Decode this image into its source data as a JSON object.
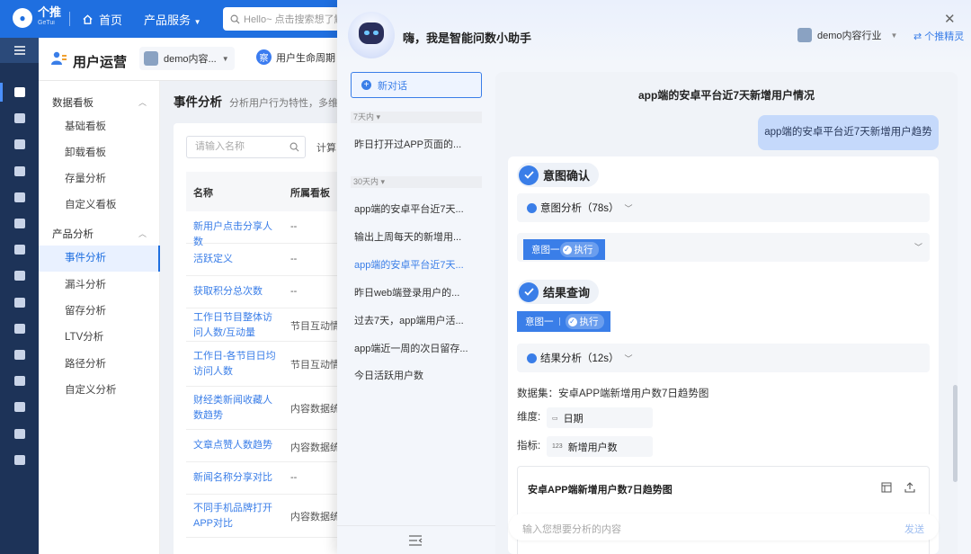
{
  "topbar": {
    "logo_text": "个推",
    "logo_sub": "GeTui",
    "home_label": "首页",
    "product_services": "产品服务",
    "search_placeholder": "Hello~ 点击搜索想了解"
  },
  "subheader": {
    "title": "用户运营",
    "demo_select": "demo内容...",
    "lifecycle_badge": "察",
    "lifecycle_label": "用户生命周期"
  },
  "leftnav": {
    "groups": [
      {
        "label": "数据看板",
        "items": [
          "基础看板",
          "卸载看板",
          "存量分析",
          "自定义看板"
        ]
      },
      {
        "label": "产品分析",
        "items": [
          "事件分析",
          "漏斗分析",
          "留存分析",
          "LTV分析",
          "路径分析",
          "自定义分析"
        ]
      }
    ],
    "active_item": "事件分析"
  },
  "main": {
    "title": "事件分析",
    "subtitle": "分析用户行为特性，多维对",
    "filter_placeholder": "请输入名称",
    "calc_label": "计算",
    "columns": [
      "名称",
      "所属看板"
    ],
    "rows": [
      {
        "name": "新用户点击分享人数",
        "group": "--"
      },
      {
        "name": "活跃定义",
        "group": "--"
      },
      {
        "name": "获取积分总次数",
        "group": "--"
      },
      {
        "name": "工作日节目整体访问人数/互动量",
        "group": "节目互动情"
      },
      {
        "name": "工作日-各节目日均访问人数",
        "group": "节目互动情"
      },
      {
        "name": "财经类新闻收藏人数趋势",
        "group": "内容数据统"
      },
      {
        "name": "文章点赞人数趋势",
        "group": "内容数据统"
      },
      {
        "name": "新闻名称分享对比",
        "group": "--"
      },
      {
        "name": "不同手机品牌打开APP对比",
        "group": "内容数据统"
      }
    ]
  },
  "assistant": {
    "greeting": "嗨，我是智能问数小助手",
    "industry": "demo内容行业",
    "elf_link": "个推精灵",
    "new_chat": "新对话",
    "history": [
      {
        "group": "7天内",
        "items": [
          "昨日打开过APP页面的..."
        ]
      },
      {
        "group": "30天内",
        "items": [
          "app端的安卓平台近7天...",
          "输出上周每天的新增用...",
          "app端的安卓平台近7天...",
          "昨日web端登录用户的...",
          "过去7天，app端用户活...",
          "app端近一周的次日留存...",
          "今日活跃用户数"
        ]
      }
    ],
    "active_history_index": 2,
    "chat": {
      "title": "app端的安卓平台近7天新增用户情况",
      "user_message": "app端的安卓平台近7天新增用户趋势",
      "intent_section": "意图确认",
      "intent_analysis": "意图分析（78s）",
      "intent_chip": "意图一",
      "execute_label": "执行",
      "result_section": "结果查询",
      "result_analysis": "结果分析（12s）",
      "dataset_label": "数据集：安卓APP端新增用户数7日趋势图",
      "dimension_label": "维度:",
      "dimension_value": "日期",
      "metric_label": "指标:",
      "metric_icon_text": "123",
      "metric_value": "新增用户数",
      "chart_title": "安卓APP端新增用户数7日趋势图",
      "input_placeholder": "输入您想要分析的内容",
      "send_label": "发送"
    }
  },
  "colors": {
    "primary": "#1f6fe0",
    "sidebar_dark": "#1d3358",
    "accent_blue": "#3a7ee8",
    "user_bubble": "#c5d9fb"
  }
}
